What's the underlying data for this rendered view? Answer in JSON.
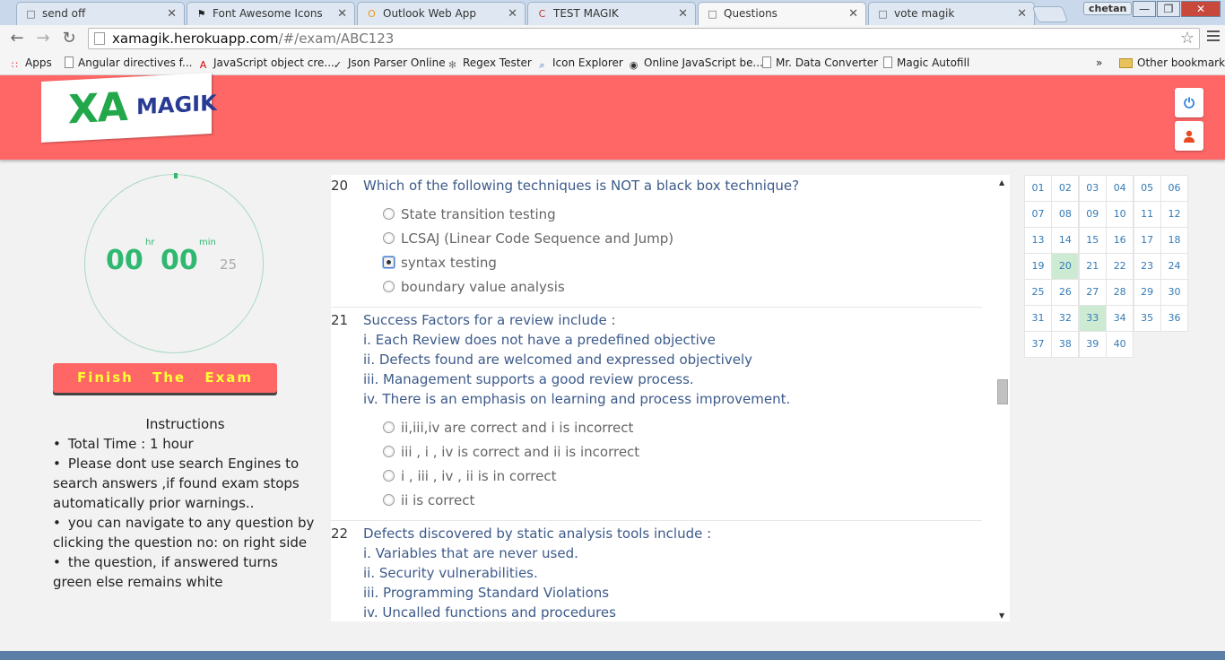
{
  "browser": {
    "tabs": [
      {
        "title": "send off",
        "icon": "doc-icon",
        "active": false
      },
      {
        "title": "Font Awesome Icons",
        "icon": "flag-icon",
        "active": false
      },
      {
        "title": "Outlook Web App",
        "icon": "outlook-icon",
        "active": false
      },
      {
        "title": "TEST MAGIK",
        "icon": "csr-icon",
        "active": false
      },
      {
        "title": "Questions",
        "icon": "doc-icon",
        "active": true
      },
      {
        "title": "vote magik",
        "icon": "doc-icon",
        "active": false
      }
    ],
    "profile_name": "chetan",
    "url_host": "xamagik.herokuapp.com",
    "url_path": "/#/exam/ABC123",
    "bookmarks": [
      {
        "label": "Apps",
        "icon": "apps-grid-icon"
      },
      {
        "label": "Angular directives f...",
        "icon": "doc-icon"
      },
      {
        "label": "JavaScript object cre...",
        "icon": "adobe-icon"
      },
      {
        "label": "Json Parser Online",
        "icon": "json-icon"
      },
      {
        "label": "Regex Tester",
        "icon": "regex-icon"
      },
      {
        "label": "Icon Explorer",
        "icon": "magnifier-icon"
      },
      {
        "label": "Online JavaScript be...",
        "icon": "owl-icon"
      },
      {
        "label": "Mr. Data Converter",
        "icon": "doc-icon"
      },
      {
        "label": "Magic Autofill",
        "icon": "doc-icon"
      }
    ],
    "bookmarks_overflow": "»",
    "other_bookmarks": "Other bookmarks"
  },
  "app": {
    "logo_xa": "XA",
    "logo_magik": "MAGIK",
    "power_icon": "power-icon",
    "user_icon": "user-icon"
  },
  "timer": {
    "hours": "00",
    "hours_label": "hr",
    "minutes": "00",
    "minutes_label": "min",
    "seconds": "25"
  },
  "finish_label": "Finish The Exam",
  "instructions": {
    "heading": "Instructions",
    "items": [
      "Total Time : 1 hour",
      "Please dont use search Engines to search answers ,if found exam stops automatically prior warnings..",
      "you can navigate to any question by clicking the question no: on right side",
      "the question, if answered turns green else remains white"
    ]
  },
  "questions": [
    {
      "number": "20",
      "text": "Which of the following techniques is NOT a black box technique?",
      "statements": [],
      "options": [
        {
          "label": "State transition testing",
          "selected": false
        },
        {
          "label": "LCSAJ (Linear Code Sequence and Jump)",
          "selected": false
        },
        {
          "label": "syntax testing",
          "selected": true
        },
        {
          "label": "boundary value analysis",
          "selected": false
        }
      ]
    },
    {
      "number": "21",
      "text": "Success Factors for a review include :",
      "statements": [
        "i. Each Review does not have a predefined objective",
        "ii. Defects found are welcomed and expressed objectively",
        "iii. Management supports a good review process.",
        "iv. There is an emphasis on learning and process improvement."
      ],
      "options": [
        {
          "label": "ii,iii,iv are correct and i is incorrect",
          "selected": false
        },
        {
          "label": "iii , i , iv is correct and ii is incorrect",
          "selected": false
        },
        {
          "label": "i , iii , iv , ii is in correct",
          "selected": false
        },
        {
          "label": "ii is correct",
          "selected": false
        }
      ]
    },
    {
      "number": "22",
      "text": "Defects discovered by static analysis tools include :",
      "statements": [
        "i. Variables that are never used.",
        "ii. Security vulnerabilities.",
        "iii. Programming Standard Violations",
        "iv. Uncalled functions and procedures"
      ],
      "options": []
    }
  ],
  "question_grid": {
    "numbers": [
      "01",
      "02",
      "03",
      "04",
      "05",
      "06",
      "07",
      "08",
      "09",
      "10",
      "11",
      "12",
      "13",
      "14",
      "15",
      "16",
      "17",
      "18",
      "19",
      "20",
      "21",
      "22",
      "23",
      "24",
      "25",
      "26",
      "27",
      "28",
      "29",
      "30",
      "31",
      "32",
      "33",
      "34",
      "35",
      "36",
      "37",
      "38",
      "39",
      "40"
    ],
    "answered": [
      "20",
      "33"
    ]
  },
  "colors": {
    "header_bg": "#ff6666",
    "accent_green": "#2fb870",
    "answered_bg": "#cdebd3",
    "finish_text": "#ffff33"
  }
}
